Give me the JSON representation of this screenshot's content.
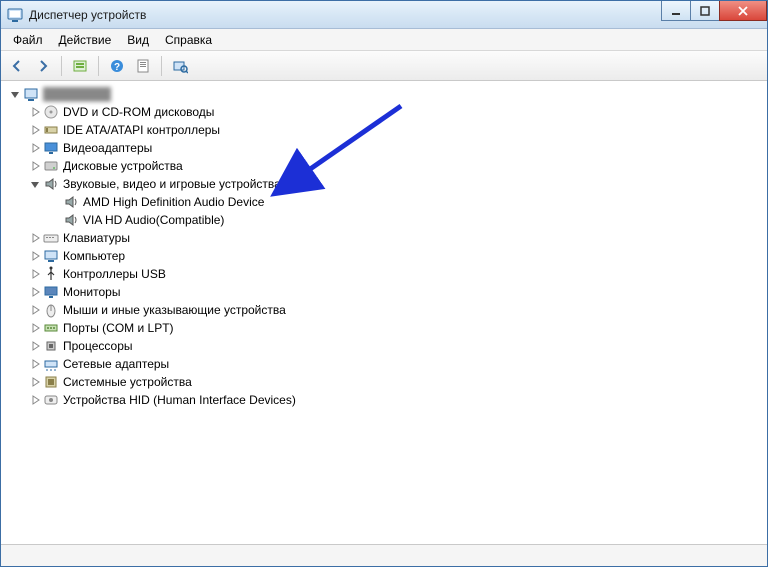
{
  "window": {
    "title": "Диспетчер устройств"
  },
  "menu": {
    "file": "Файл",
    "action": "Действие",
    "view": "Вид",
    "help": "Справка"
  },
  "toolbar": {
    "back": "back",
    "forward": "forward",
    "show_hidden": "show-hidden",
    "help": "help",
    "properties": "properties",
    "scan": "scan"
  },
  "tree": {
    "root": "",
    "items": [
      {
        "label": "DVD и CD-ROM дисководы",
        "icon": "disc",
        "expanded": false
      },
      {
        "label": "IDE ATA/ATAPI контроллеры",
        "icon": "ide",
        "expanded": false
      },
      {
        "label": "Видеоадаптеры",
        "icon": "display",
        "expanded": false
      },
      {
        "label": "Дисковые устройства",
        "icon": "drive",
        "expanded": false
      },
      {
        "label": "Звуковые, видео и игровые устройства",
        "icon": "sound",
        "expanded": true,
        "children": [
          {
            "label": "AMD High Definition Audio Device",
            "icon": "sound"
          },
          {
            "label": "VIA HD Audio(Compatible)",
            "icon": "sound"
          }
        ]
      },
      {
        "label": "Клавиатуры",
        "icon": "keyboard",
        "expanded": false
      },
      {
        "label": "Компьютер",
        "icon": "computer",
        "expanded": false
      },
      {
        "label": "Контроллеры USB",
        "icon": "usb",
        "expanded": false
      },
      {
        "label": "Мониторы",
        "icon": "monitor",
        "expanded": false
      },
      {
        "label": "Мыши и иные указывающие устройства",
        "icon": "mouse",
        "expanded": false
      },
      {
        "label": "Порты (COM и LPT)",
        "icon": "port",
        "expanded": false
      },
      {
        "label": "Процессоры",
        "icon": "cpu",
        "expanded": false
      },
      {
        "label": "Сетевые адаптеры",
        "icon": "network",
        "expanded": false
      },
      {
        "label": "Системные устройства",
        "icon": "system",
        "expanded": false
      },
      {
        "label": "Устройства HID (Human Interface Devices)",
        "icon": "hid",
        "expanded": false
      }
    ]
  }
}
